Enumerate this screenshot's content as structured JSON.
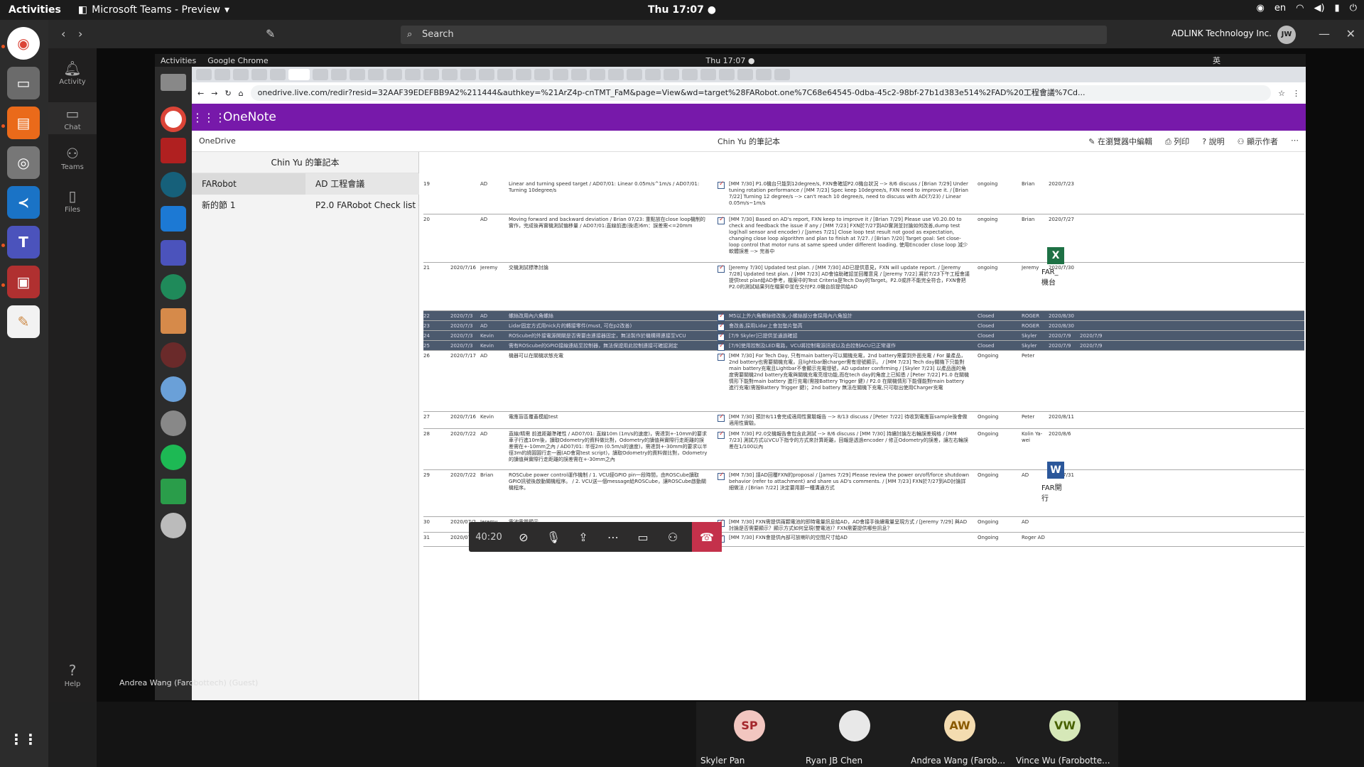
{
  "topbar": {
    "activities": "Activities",
    "app_name": "Microsoft Teams - Preview",
    "clock": "Thu 17:07 ●",
    "lang": "en"
  },
  "teams": {
    "search_placeholder": "Search",
    "org": "ADLINK Technology Inc.",
    "me_initials": "JW",
    "rail": [
      "Activity",
      "Chat",
      "Teams",
      "Files",
      "Help"
    ]
  },
  "inner": {
    "activities": "Activities",
    "browser": "Google Chrome",
    "clock": "Thu 17:07 ●",
    "lang": "英"
  },
  "browser": {
    "url": "onedrive.live.com/redir?resid=32AAF39EDEFBB9A2%211444&authkey=%21ArZ4p-cnTMT_FaM&page=View&wd=target%28FARobot.one%7C68e64545-0dba-45c2-98bf-27b1d383e514%2FAD%20工程會議%7Cd..."
  },
  "onenote": {
    "app": "OneNote",
    "onedrive": "OneDrive",
    "notebook": "Chin Yu 的筆記本",
    "edit": "在瀏覽器中編輯",
    "print": "列印",
    "help": "說明",
    "authors": "顯示作者",
    "sections": [
      "FARobot",
      "新的節 1"
    ],
    "pages": [
      "AD 工程會議",
      "P2.0 FARobot Check list ( ..."
    ]
  },
  "rows": [
    {
      "n": "19",
      "date": "",
      "owner": "AD",
      "item": "Linear and turning speed target / AD07/01: Linear 0.05m/s^1m/s / AD07/01: Turning 10degree/s",
      "notes": "[MM 7/30] P1.0機台只能到12degree/s, FXN會確認P2.0機台狀況 --> 8/6 discuss / [Brian 7/29] Under tuning rotation performance / [MM 7/23] Spec keep 10degree/s, FXN need to improve it. / [Brian 7/22] Turning 12 degree/s --> can't reach 10 degree/s, need to discuss with AD(7/23) / Linear 0.05m/s~1m/s",
      "status": "ongoing",
      "who": "Brian",
      "due": "2020/7/23",
      "done": ""
    },
    {
      "n": "20",
      "date": "",
      "owner": "AD",
      "item": "Moving forward and backward deviation / Brian 07/23: 重點放在close loop機制的實作，完成後再實機測試偏移量 / AD07/01:直線前進(後退)6m：誤差需<=20mm",
      "notes": "[MM 7/30] Based on AD's report, FXN keep to improve it / [Brian 7/29] Please use V0.20.00 to check and feedback the issue if any / [MM 7/23] FXN於7/27到AD實測並討論如何改善,dump test log(hall sensor and encoder) / [James 7/21] Close loop test result not good as expectation, changing close loop algorithm and plan to finish at 7/27. / [Brian 7/20] Target goal: Set close-loop control that motor runs at same speed under different loading. 使用Encoder close loop 減少軟體誤差 --> 完善中",
      "status": "ongoing",
      "who": "Brian",
      "due": "2020/7/27",
      "done": ""
    },
    {
      "n": "21",
      "date": "2020/7/16",
      "owner": "Jeremy",
      "item": "交機測試標準討論",
      "notes": "[Jeremy 7/30] Updated test plan. / [MM 7/30] AD已提供意見，FXN will update report. / [Jeremy 7/28] Updated test plan. / [MM 7/23] AD會協助確認並回覆意見 / [Jeremy 7/22] 將於7/23下午工程會議提供test plan給AD參考，檔案中的Test Criteria是Tech Day的Target。P2.0或許不能完全符合，FXN會把P2.0的測試結果列在檔案中並在交付P2.0機台前提供給AD",
      "status": "ongoing",
      "who": "Jeremy",
      "due": "2020/7/30",
      "done": ""
    },
    {
      "n": "22",
      "date": "2020/7/3",
      "owner": "AD",
      "item": "螺絲改用內六角螺絲",
      "notes": "M5以上外六角螺絲修改後,小螺絲部分會採用內六角設計",
      "status": "Closed",
      "who": "ROGER",
      "due": "2020/8/30",
      "done": ""
    },
    {
      "n": "23",
      "date": "2020/7/3",
      "owner": "AD",
      "item": "Lidar固定方式用nick片的轉接零件(must, 可在p2改善)",
      "notes": "會改善,採用Lidar上會加墊片墊高",
      "status": "Closed",
      "who": "ROGER",
      "due": "2020/8/30",
      "done": ""
    },
    {
      "n": "24",
      "date": "2020/7/3",
      "owner": "Kevin",
      "item": "ROScube的外接電源開關是否需要由連接器固定，無法製作於機構得連接至VCU",
      "notes": "[7/9 Skyler]已提供並通過確認",
      "status": "Closed",
      "who": "Skyler",
      "due": "2020/7/9",
      "done": "2020/7/9"
    },
    {
      "n": "25",
      "date": "2020/7/3",
      "owner": "Kevin",
      "item": "需有ROScube的GPIO接線連結至控制器，無法保證用此控制連接可確認測定",
      "notes": "[7/9]使用控制及LED電路，VCU將控制電源訊號以及由控制ACU已正常運作",
      "status": "Closed",
      "who": "Skyler",
      "due": "2020/7/9",
      "done": "2020/7/9"
    },
    {
      "n": "26",
      "date": "2020/7/17",
      "owner": "AD",
      "item": "機器可以在關機狀態充電",
      "notes": "[MM 7/30] For Tech Day, 只有main battery可以關機充電，2nd battery需要到外面充電 / For 量產品，2nd battery也需要關機充電，且lightbar跟charger需有燈號顯示。 / [MM 7/23] Tech day關機下只能對main battery充電且Lightbar不會顯示充電燈號，AD updater confirming / [Skyler 7/23] 以產品面的角度需要關機2nd battery充電與關機充電亮燈功能,而在tech day的角度上已知悉 / [Peter 7/22] P1.0 在關機情形下能對main battery 進行充電(需按Battery Trigger 鍵) / P2.0 在關機情形下能僅能對main battery 進行充電(需按Battery Trigger 鍵)；2nd battery 無法在關機下充電,只可取出使用Charger充電",
      "status": "Ongoing",
      "who": "Peter",
      "due": "",
      "done": ""
    },
    {
      "n": "27",
      "date": "2020/7/16",
      "owner": "Kevin",
      "item": "電應盲區覆蓋模組test",
      "notes": "[MM 7/30] 預計8/11會完成適用性實驗報告 --> 8/13 discuss / [Peter 7/22] 待收到電應盲sample後會做適用性實驗。",
      "status": "Ongoing",
      "who": "Peter",
      "due": "2020/8/11",
      "done": ""
    },
    {
      "n": "28",
      "date": "2020/7/22",
      "owner": "AD",
      "item": "直線/精需 前進距離準確性 / AD07/01: 直線10m (1m/s的速度)，需達到+-10mm的要求車子行進10m後，讀取Odometry的資料做比對，Odometry的讀值與實際行走距離的誤差需在+-10mm之內 / AD07/01: 半徑2m (0.5m/s的速度)，需達到+-30mm的要求以半徑3m的繞圓圓行走一圈(AD會寫test script)，讀取Odometry的資料做比對，Odometry的讀值與實際行走距離的誤差需在+-30mm之內",
      "notes": "[MM 7/30] P2.0交機報告會包含此測試 --> 8/6 discuss / [MM 7/30] 持續討論左右輪誤差規格 / [MM 7/23] 測試方式以VCU下指令的方式來計算距離，回報是透過encoder / 修正Odometry的誤差，讓左右輪誤差在1/100以內",
      "status": "Ongoing",
      "who": "Kolin Ya-wei",
      "due": "2020/8/6",
      "done": ""
    },
    {
      "n": "29",
      "date": "2020/7/22",
      "owner": "Brian",
      "item": "ROSCube power control運作機制 / 1. VCU經GPIO pin一段時間，由ROSCube讀取GPIO訊號後啟動關機程序。 / 2. VCU送一個message給ROSCube，讓ROSCube啟動關機程序。",
      "notes": "[MM 7/30] 請AD回覆FXN的proposal / [James 7/29] Please review the power on/off/force shutdown behavior (refer to attachment) and share us AD's comments. / [MM 7/23] FXN於7/27到AD討論詳細做法 / [Brian 7/22] 決定要用那一種溝通方式",
      "status": "Ongoing",
      "who": "AD",
      "due": "2020/7/31",
      "done": ""
    },
    {
      "n": "30",
      "date": "2020/07/29",
      "owner": "Jeremy",
      "item": "電池電量顯示",
      "notes": "[MM 7/30] FXN需提供兩顆電池的即時電量訊息給AD，AD會接手後續電量呈現方式 / [Jeremy 7/29] 與AD討論是否需要顯示？顯示方式如何呈現(雙電池)？FXN需要提供哪些訊息？",
      "status": "Ongoing",
      "who": "AD",
      "due": "",
      "done": ""
    },
    {
      "n": "31",
      "date": "2020/07/30",
      "owner": "AD",
      "item": "增加藍牙(or USB)喇叭的放置位置",
      "notes": "[MM 7/30] FXN會提供內部可放喇叭的空間尺寸給AD",
      "status": "Ongoing",
      "who": "Roger AD",
      "due": "",
      "done": ""
    }
  ],
  "call": {
    "timer": "40:20",
    "presenter": "Andrea Wang (Farobottech) (Guest)"
  },
  "participants": [
    {
      "initials": "SP",
      "name": "Skyler Pan",
      "color": "#f2c6c0",
      "text": "#a4262c"
    },
    {
      "initials": "",
      "name": "Ryan JB Chen",
      "color": "#e8e8e8",
      "text": "#333"
    },
    {
      "initials": "AW",
      "name": "Andrea Wang (Farob...",
      "color": "#f4dcb0",
      "text": "#8a5a00"
    },
    {
      "initials": "VW",
      "name": "Vince Wu (Farobotte...",
      "color": "#d6e8b8",
      "text": "#476100"
    }
  ],
  "attachments": {
    "excel_label": "FAR_ 機台",
    "word_label": "FAR開 行"
  }
}
